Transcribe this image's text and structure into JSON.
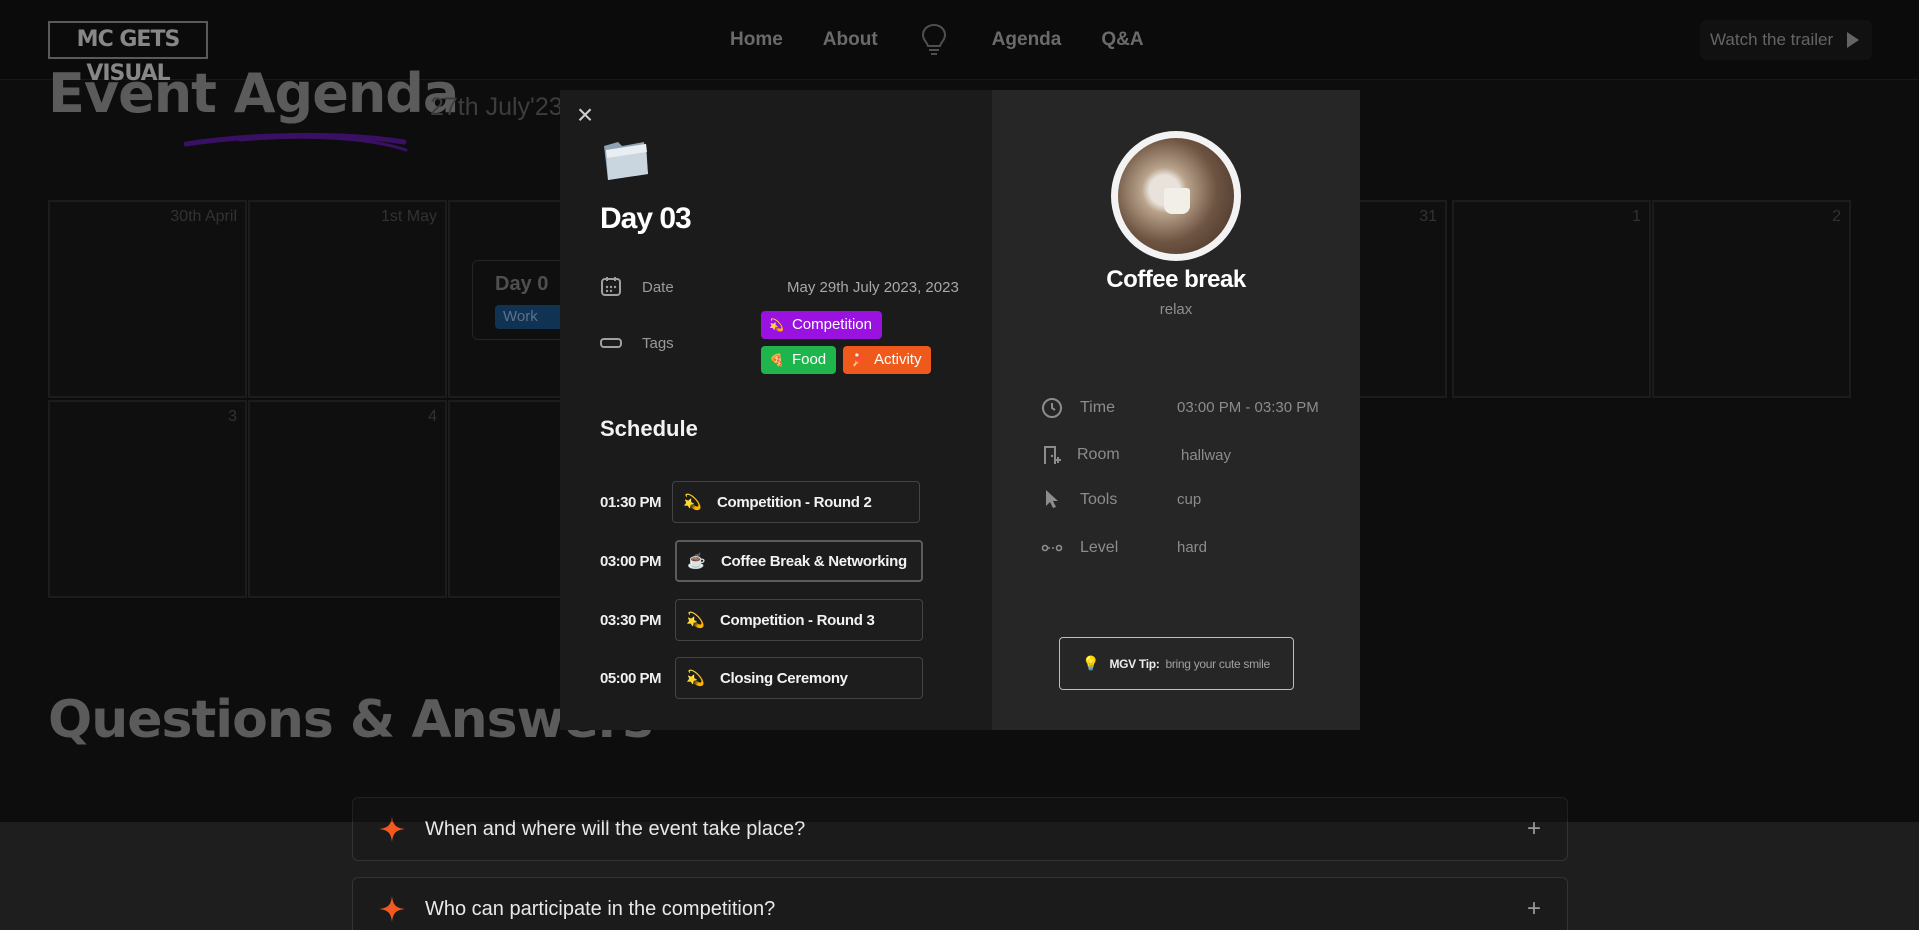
{
  "nav": {
    "logo": "MC GETS VISUAL",
    "links": [
      "Home",
      "About",
      "Agenda",
      "Q&A"
    ],
    "trailer": "Watch the trailer"
  },
  "agenda": {
    "title": "Event Agenda",
    "date": "27th July'23",
    "calendar": {
      "row1": [
        "30th April",
        "1st May",
        "",
        "",
        "",
        "",
        "31",
        "1",
        "2"
      ],
      "row2": [
        "3",
        "4",
        ""
      ],
      "chip_title": "Day 0",
      "chip_tag": "Work"
    }
  },
  "qa": {
    "title": "Questions & Answers",
    "items": [
      "When and where will the event take place?",
      "Who can participate in the competition?"
    ]
  },
  "modal": {
    "close": "×",
    "day_title": "Day 03",
    "date_label": "Date",
    "date_value": "May 29th July 2023, 2023",
    "tags_label": "Tags",
    "tags": [
      {
        "label": "Competition",
        "icon": "💫",
        "color": "#9a12e0"
      },
      {
        "label": "Food",
        "icon": "🍕",
        "color": "#1fb54d"
      },
      {
        "label": "Activity",
        "icon": "🏓",
        "color": "#ef5a1c"
      }
    ],
    "schedule_title": "Schedule",
    "schedule": [
      {
        "time": "01:30 PM",
        "icon": "💫",
        "label": "Competition - Round 2"
      },
      {
        "time": "03:00 PM",
        "icon": "☕",
        "label": "Coffee Break & Networking"
      },
      {
        "time": "03:30 PM",
        "icon": "💫",
        "label": "Competition - Round 3"
      },
      {
        "time": "05:00 PM",
        "icon": "💫",
        "label": "Closing Ceremony"
      }
    ],
    "detail": {
      "title": "Coffee break",
      "subtitle": "relax",
      "rows": [
        {
          "label": "Time",
          "value": "03:00 PM - 03:30 PM",
          "icon": "clock-icon"
        },
        {
          "label": "Room",
          "value": "hallway",
          "icon": "door-icon"
        },
        {
          "label": "Tools",
          "value": "cup",
          "icon": "cursor-icon"
        },
        {
          "label": "Level",
          "value": "hard",
          "icon": "level-icon"
        }
      ],
      "tip_label": "MGV Tip:",
      "tip_value": "bring your cute smile"
    }
  }
}
